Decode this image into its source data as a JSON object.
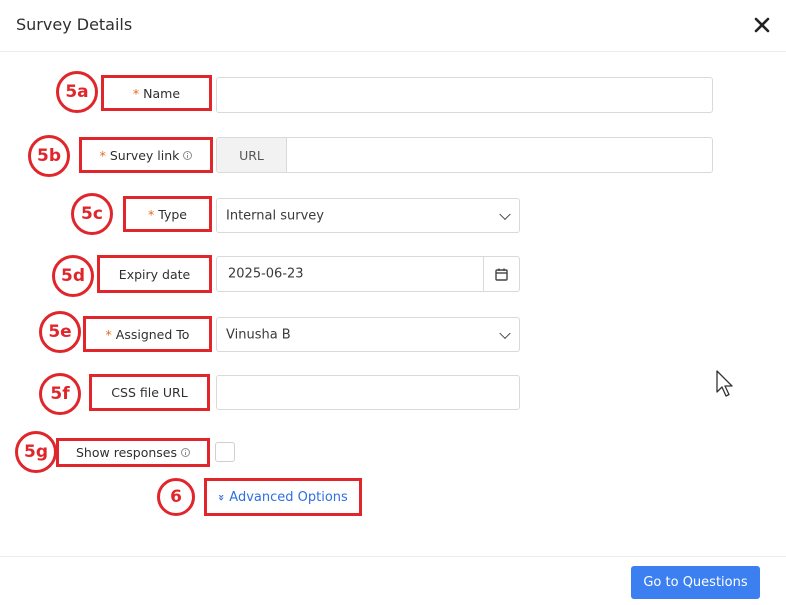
{
  "modal": {
    "title": "Survey Details",
    "close_icon": "close-icon"
  },
  "form": {
    "name": {
      "badge": "5a",
      "label": "Name",
      "required": "*",
      "value": ""
    },
    "survey_link": {
      "badge": "5b",
      "label": "Survey link",
      "required": "*",
      "addon": "URL",
      "value": ""
    },
    "type": {
      "badge": "5c",
      "label": "Type",
      "required": "*",
      "value": "Internal survey"
    },
    "expiry_date": {
      "badge": "5d",
      "label": "Expiry date",
      "value": "2025-06-23"
    },
    "assigned_to": {
      "badge": "5e",
      "label": "Assigned To",
      "required": "*",
      "value": "Vinusha B"
    },
    "css_file_url": {
      "badge": "5f",
      "label": "CSS file URL",
      "value": ""
    },
    "show_responses": {
      "badge": "5g",
      "label": "Show responses",
      "checked": false
    },
    "advanced": {
      "badge": "6",
      "icon": "»",
      "label": "Advanced Options"
    }
  },
  "footer": {
    "primary_label": "Go to Questions"
  },
  "colors": {
    "annotation_red": "#e0262b",
    "required_orange": "#e8691f",
    "link_blue": "#2f6fe0",
    "primary_blue": "#3b7ff0"
  }
}
